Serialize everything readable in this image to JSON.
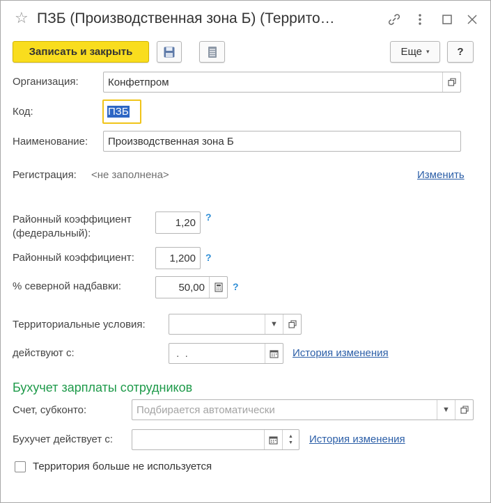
{
  "window": {
    "title": "ПЗБ (Производственная зона Б) (Террито…"
  },
  "toolbar": {
    "save_close_label": "Записать и закрыть",
    "more_label": "Еще",
    "help_label": "?"
  },
  "form": {
    "organization": {
      "label": "Организация:",
      "value": "Конфетпром"
    },
    "code": {
      "label": "Код:",
      "value": "ПЗБ"
    },
    "name": {
      "label": "Наименование:",
      "value": "Производственная зона Б"
    },
    "registration": {
      "label": "Регистрация:",
      "value": "<не заполнена>",
      "action": "Изменить"
    },
    "district_coef_fed": {
      "label_line1": "Районный коэффициент",
      "label_line2": "(федеральный):",
      "value": "1,20",
      "help": "?"
    },
    "district_coef": {
      "label": "Районный коэффициент:",
      "value": "1,200",
      "help": "?"
    },
    "north_bonus": {
      "label": "% северной надбавки:",
      "value": "50,00",
      "help": "?"
    },
    "territorial_conditions": {
      "label": "Территориальные условия:",
      "value": ""
    },
    "valid_from": {
      "label": "действуют с:",
      "value": " .  .",
      "history": "История изменения"
    }
  },
  "accounting": {
    "section_title": "Бухучет зарплаты сотрудников",
    "account": {
      "label": "Счет, субконто:",
      "placeholder": "Подбирается автоматически"
    },
    "valid_from": {
      "label": "Бухучет действует с:",
      "value": "",
      "history": "История изменения"
    },
    "not_used": {
      "label": "Территория больше не используется",
      "checked": false
    }
  },
  "colors": {
    "primary_button": "#f9dd1e",
    "link": "#2b5ea7",
    "section_title": "#1e9a4a",
    "focus_border": "#f0c419",
    "selection": "#2d66c4"
  }
}
